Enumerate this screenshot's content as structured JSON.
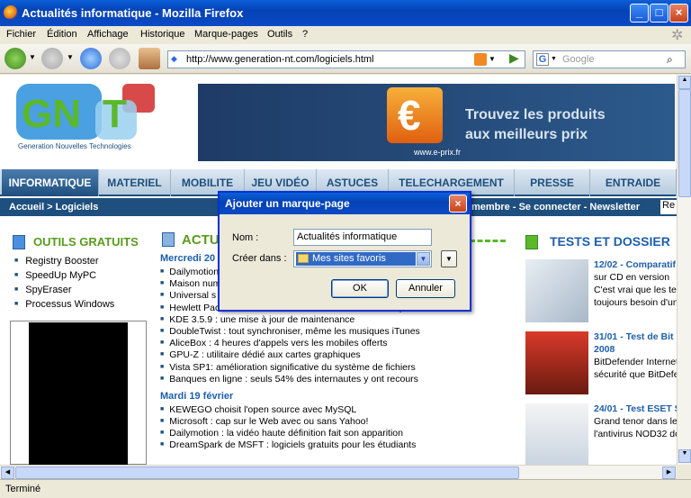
{
  "window": {
    "title": "Actualités informatique - Mozilla Firefox"
  },
  "menu": [
    "Fichier",
    "Édition",
    "Affichage",
    "Historique",
    "Marque-pages",
    "Outils",
    "?"
  ],
  "url": "http://www.generation-nt.com/logiciels.html",
  "search": {
    "placeholder": "Google"
  },
  "status": "Terminé",
  "page": {
    "logo_sub": "Generation Nouvelles Technologies",
    "banner": {
      "line1": "Trouvez les produits",
      "line2": "aux meilleurs prix",
      "brand": "www.e-prix.fr"
    },
    "tabs": [
      "INFORMATIQUE",
      "MATERIEL",
      "MOBILITE",
      "JEU VIDÉO",
      "ASTUCES",
      "TELECHARGEMENT",
      "PRESSE",
      "ENTRAIDE"
    ],
    "breadcrumb": "Accueil > Logiciels",
    "account": "membre - Se connecter - Newsletter",
    "account_extra": "Re",
    "outils_title": "OUTILS GRATUITS",
    "outils": [
      "Registry Booster",
      "SpeedUp MyPC",
      "SpyEraser",
      "Processus Windows"
    ],
    "actu_title": "ACTU",
    "news": [
      {
        "date": "Mercredi 20",
        "items": [
          "Dailymotion",
          "Maison num",
          "Universal s",
          "Hewlett Packard : 2008 débute sous les meilleures auspices",
          "KDE 3.5.9 : une mise à jour de maintenance",
          "DoubleTwist : tout synchroniser, même les musiques iTunes",
          "AliceBox : 4 heures d'appels vers les mobiles offerts",
          "GPU-Z : utilitaire dédié aux cartes graphiques",
          "Vista SP1: amélioration significative du système de fichiers",
          "Banques en ligne : seuls 54% des internautes y ont recours"
        ]
      },
      {
        "date": "Mardi 19 février",
        "items": [
          "KEWEGO choisit l'open source avec MySQL",
          "Microsoft : cap sur le Web avec ou sans Yahoo!",
          "Dailymotion : la vidéo haute définition fait son apparition",
          "DreamSpark de MSFT : logiciels gratuits pour les étudiants"
        ]
      }
    ],
    "tests_title": "TESTS ET DOSSIER",
    "tests": [
      {
        "title": "12/02 - Comparatif",
        "lines": [
          "sur CD en version",
          "C'est vrai que les te",
          "toujours besoin d'un"
        ]
      },
      {
        "title": "31/01 - Test de Bit",
        "lines": [
          "2008",
          "BitDefender Internet",
          "sécurité que BitDefen"
        ]
      },
      {
        "title": "24/01 - Test ESET S",
        "lines": [
          "Grand tenor dans les",
          "l'antivirus NOD32 do"
        ]
      }
    ]
  },
  "dialog": {
    "title": "Ajouter un marque-page",
    "name_label": "Nom :",
    "name_value": "Actualités informatique",
    "folder_label": "Créer dans :",
    "folder_value": "Mes sites favoris",
    "ok": "OK",
    "cancel": "Annuler"
  }
}
